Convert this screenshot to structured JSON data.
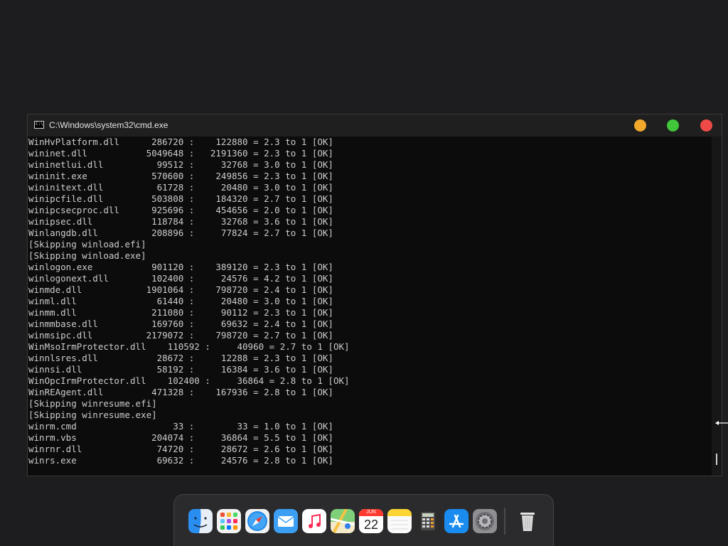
{
  "window": {
    "title": "C:\\Windows\\system32\\cmd.exe",
    "icon_text": "C:\\"
  },
  "console_lines": [
    "WinHvPlatform.dll      286720 :    122880 = 2.3 to 1 [OK]",
    "wininet.dll           5049648 :   2191360 = 2.3 to 1 [OK]",
    "wininetlui.dll          99512 :     32768 = 3.0 to 1 [OK]",
    "wininit.exe            570600 :    249856 = 2.3 to 1 [OK]",
    "wininitext.dll          61728 :     20480 = 3.0 to 1 [OK]",
    "winipcfile.dll         503808 :    184320 = 2.7 to 1 [OK]",
    "winipcsecproc.dll      925696 :    454656 = 2.0 to 1 [OK]",
    "winipsec.dll           118784 :     32768 = 3.6 to 1 [OK]",
    "Winlangdb.dll          208896 :     77824 = 2.7 to 1 [OK]",
    "[Skipping winload.efi]",
    "[Skipping winload.exe]",
    "winlogon.exe           901120 :    389120 = 2.3 to 1 [OK]",
    "winlogonext.dll        102400 :     24576 = 4.2 to 1 [OK]",
    "winmde.dll            1901064 :    798720 = 2.4 to 1 [OK]",
    "winml.dll               61440 :     20480 = 3.0 to 1 [OK]",
    "winmm.dll              211080 :     90112 = 2.3 to 1 [OK]",
    "winmmbase.dll          169760 :     69632 = 2.4 to 1 [OK]",
    "winmsipc.dll          2179072 :    798720 = 2.7 to 1 [OK]",
    "WinMsoIrmProtector.dll    110592 :     40960 = 2.7 to 1 [OK]",
    "winnlsres.dll           28672 :     12288 = 2.3 to 1 [OK]",
    "winnsi.dll              58192 :     16384 = 3.6 to 1 [OK]",
    "WinOpcIrmProtector.dll    102400 :     36864 = 2.8 to 1 [OK]",
    "WinREAgent.dll         471328 :    167936 = 2.8 to 1 [OK]",
    "[Skipping winresume.efi]",
    "[Skipping winresume.exe]",
    "winrm.cmd                  33 :        33 = 1.0 to 1 [OK]",
    "winrm.vbs              204074 :     36864 = 5.5 to 1 [OK]",
    "winrnr.dll              74720 :     28672 = 2.6 to 1 [OK]",
    "winrs.exe               69632 :     24576 = 2.8 to 1 [OK]"
  ],
  "controls": {
    "minimize_color": "#f0a72b",
    "maximize_color": "#41c63a",
    "close_color": "#ee4b48"
  },
  "dock": {
    "items": [
      {
        "name": "finder-icon"
      },
      {
        "name": "launchpad-icon"
      },
      {
        "name": "safari-icon"
      },
      {
        "name": "mail-icon"
      },
      {
        "name": "music-icon"
      },
      {
        "name": "maps-icon"
      },
      {
        "name": "calendar-icon"
      },
      {
        "name": "notes-icon"
      },
      {
        "name": "calculator-icon"
      },
      {
        "name": "app-store-icon"
      },
      {
        "name": "system-preferences-icon"
      },
      {
        "name": "trash-icon"
      }
    ],
    "calendar_month": "JUN",
    "calendar_day": "22"
  }
}
